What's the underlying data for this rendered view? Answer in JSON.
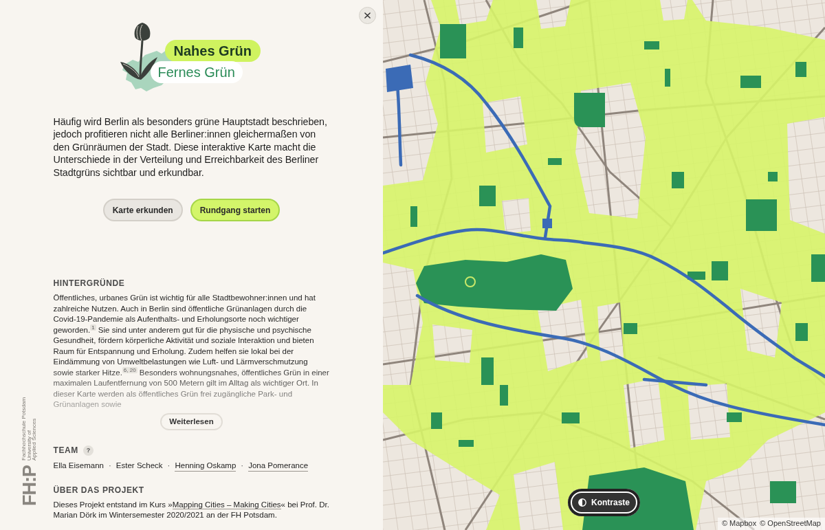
{
  "logo": {
    "title": "Nahes Grün",
    "subtitle": "Fernes Grün"
  },
  "intro": "Häufig wird Berlin als besonders grüne Hauptstadt beschrieben, jedoch profitieren nicht alle Berliner:innen gleichermaßen von den Grünräumen der Stadt. Diese interaktive Karte macht die Unterschiede in der Verteilung und Erreichbarkeit des Berliner Stadtgrüns sichtbar und erkundbar.",
  "buttons": [
    {
      "label": "Karte erkunden",
      "kind": "secondary"
    },
    {
      "label": "Rundgang starten",
      "kind": "primary"
    }
  ],
  "background": {
    "heading": "HINTERGRÜNDE",
    "text": "Öffentliches, urbanes Grün ist wichtig für alle Stadtbewohner:innen und hat zahlreiche Nutzen. Auch in Berlin sind öffentliche Grünanlagen durch die Covid-19-Pandemie als Aufenthalts- und Erholungsorte noch wichtiger geworden.$^{1}$ Sie sind unter anderem gut für die physische und psychische Gesundheit, fördern körperliche Aktivität und soziale Interaktion und bieten Raum für Entspannung und Erholung. Zudem helfen sie lokal bei der Eindämmung von Umweltbelastungen wie Luft- und Lärmverschmutzung sowie starker Hitze.$^{6, 20}$ Besonders wohnungsnahes, öffentliches Grün in einer maximalen Laufentfernung von 500 Metern gilt im Alltag als wichtiger Ort. In dieser Karte werden als öffentliches Grün frei zugängliche Park- und Grünanlagen sowie",
    "read_more": "Weiterlesen"
  },
  "team": {
    "heading": "TEAM",
    "help": "?",
    "line": [
      {
        "kind": "name",
        "text": "Ella Eisemann"
      },
      {
        "kind": "separator",
        "text": "·"
      },
      {
        "kind": "name",
        "text": "Ester Scheck"
      },
      {
        "kind": "separator",
        "text": "·"
      },
      {
        "kind": "link",
        "text": "Henning Oskamp"
      },
      {
        "kind": "separator",
        "text": "·"
      },
      {
        "kind": "link",
        "text": "Jona Pomerance"
      }
    ]
  },
  "about": {
    "heading": "ÜBER DAS PROJEKT",
    "text_before": "Dieses Projekt entstand im Kurs »",
    "link": "Mapping Cities – Making Cities",
    "text_after": "« bei Prof. Dr. Marian Dörk im Wintersemester 2020/2021 an der FH Potsdam."
  },
  "university": {
    "mark": "FH:P",
    "name_lines": [
      "Fachhochschule Potsdam",
      "University of",
      "Applied Sciences"
    ]
  },
  "map": {
    "contrast_button": "Kontraste",
    "attribution": [
      "© Mapbox",
      "© OpenStreetMap"
    ]
  }
}
